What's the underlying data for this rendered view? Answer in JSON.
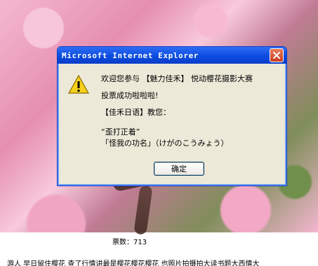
{
  "dialog": {
    "title": "Microsoft Internet Explorer",
    "lines": [
      "欢迎您参与 【魅力佳禾】 悦动樱花摄影大赛",
      "投票成功啦啦啦!",
      "【佳禾日语】教您：",
      "“歪打正着”",
      "「怪我の功名」（けがのこうみょう）"
    ],
    "ok_label": "确定",
    "icon": "warning-icon"
  },
  "votes_text": "票数：713",
  "footer_partial": "游人  早日留住樱花  查了行情讲最是樱花樱花樱花    也照片拍摄拍大读书题大西情大"
}
